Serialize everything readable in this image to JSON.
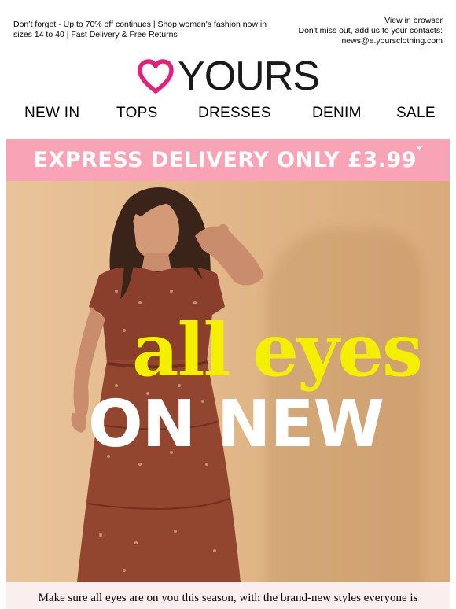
{
  "preheader": {
    "left_text": "Don’t forget - Up to 70% off continues | Shop women's fashion now in sizes 14 to 40 | Fast Delivery & Free Returns",
    "view_in_browser": "View in browser",
    "contacts_line": "Don't miss out, add us to your contacts:",
    "email": "news@e.yoursclothing.com"
  },
  "brand": {
    "name": "YOURS",
    "heart_color": "#e0227a"
  },
  "nav": {
    "items": [
      "NEW IN",
      "TOPS",
      "DRESSES",
      "DENIM",
      "SALE"
    ]
  },
  "promo": {
    "text": "EXPRESS DELIVERY ONLY £3.99",
    "asterisk": "*",
    "background": "#f9a3b6"
  },
  "hero": {
    "line1": "all eyes",
    "line2": "ON NEW",
    "line1_color": "#f4ef00",
    "line2_color": "#ffffff"
  },
  "body": {
    "text": "Make sure all eyes are on you this season, with the brand-new styles everyone is talking about! From belted maxi dresses to the clothing you'll LOVE the most..."
  }
}
